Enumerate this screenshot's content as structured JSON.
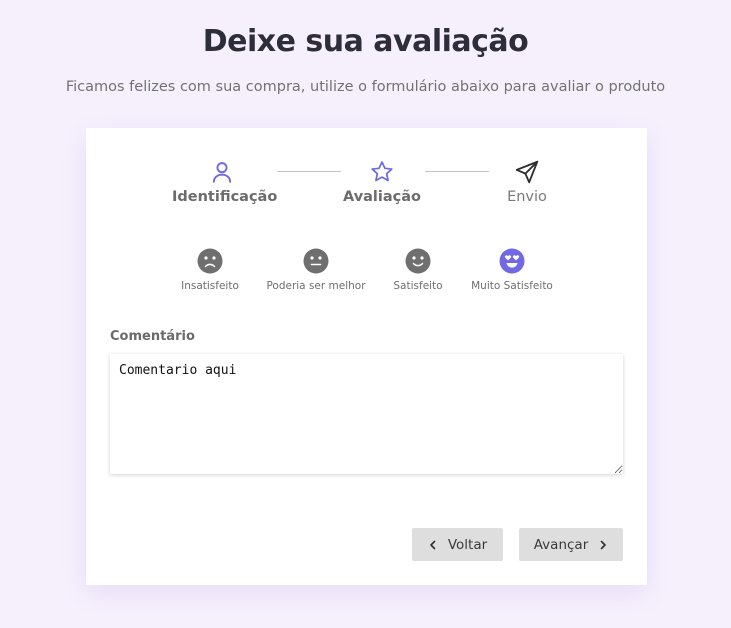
{
  "header": {
    "title": "Deixe sua avaliação",
    "subtitle": "Ficamos felizes com sua compra, utilize o formulário abaixo para avaliar o produto"
  },
  "steps": [
    {
      "label": "Identificação",
      "icon": "user-icon",
      "state": "completed"
    },
    {
      "label": "Avaliação",
      "icon": "star-icon",
      "state": "current"
    },
    {
      "label": "Envio",
      "icon": "send-icon",
      "state": "pending"
    }
  ],
  "ratings": [
    {
      "label": "Insatisfeito",
      "icon": "sad-face-icon",
      "selected": false
    },
    {
      "label": "Poderia ser melhor",
      "icon": "neutral-face-icon",
      "selected": false
    },
    {
      "label": "Satisfeito",
      "icon": "smile-face-icon",
      "selected": false
    },
    {
      "label": "Muito Satisfeito",
      "icon": "heart-eyes-face-icon",
      "selected": true
    }
  ],
  "comment": {
    "label": "Comentário",
    "value": "Comentario aqui"
  },
  "buttons": {
    "back_label": "Voltar",
    "next_label": "Avançar"
  },
  "colors": {
    "accent": "#7169e3",
    "background": "#f6f0fd",
    "rating_inactive": "#6f6f6f",
    "button_bg": "#dedede"
  }
}
